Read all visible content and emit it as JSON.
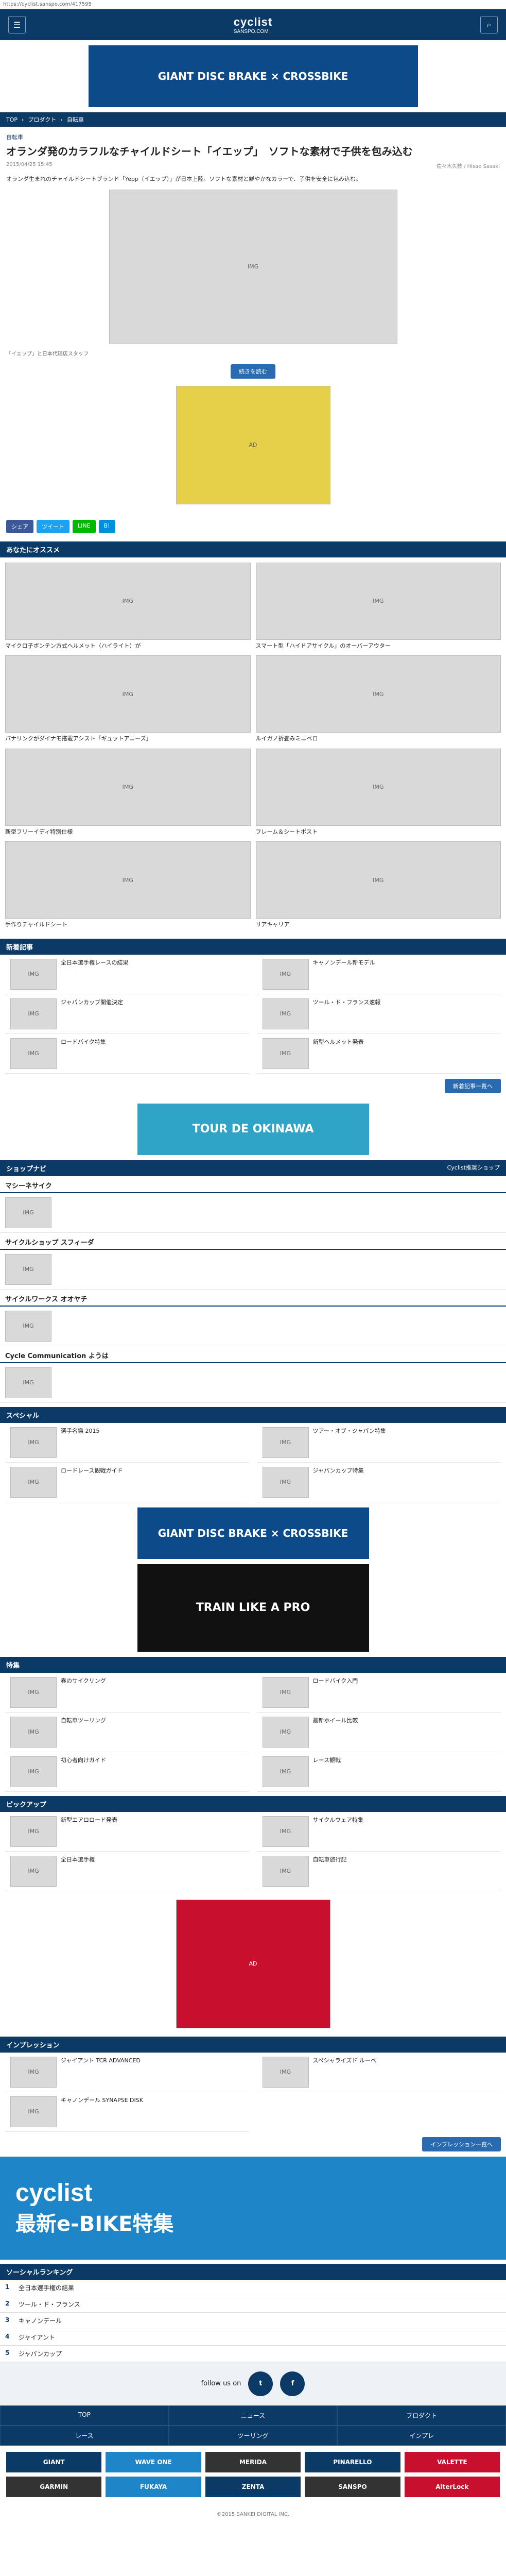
{
  "url": "https://cyclist.sanspo.com/417595",
  "header": {
    "logo": "cyclist",
    "logo_sub": "SANSPO.COM"
  },
  "banners": {
    "top": "GIANT DISC BRAKE × CROSSBIKE",
    "tour": "TOUR DE OKINAWA",
    "train": "TRAIN LIKE A PRO",
    "ebike": "最新e-BIKE特集",
    "ebike_word": "cyclist"
  },
  "breadcrumb": [
    "TOP",
    "プロダクト",
    "自転車"
  ],
  "article": {
    "category": "自転車",
    "title": "オランダ発のカラフルなチャイルドシート「イエップ」　ソフトな素材で子供を包み込む",
    "date": "2015/04/25 15:45",
    "author": "佐々木久枝 / Hisae Sasaki",
    "lead": "オランダ生まれのチャイルドシートブランド「Yepp（イエップ）」が日本上陸。ソフトな素材と鮮やかなカラーで、子供を安全に包み込む。",
    "caption": "「イエップ」と日本代理店スタッフ",
    "more_photos": "続きを読む"
  },
  "share": [
    "シェア",
    "ツイート",
    "LINE",
    "B!"
  ],
  "recommend": {
    "title": "あなたにオススメ",
    "items": [
      "マイクロ子ボンテン方式ヘルメット（ハイライト）が",
      "スマート型「ハイドアサイクル」のオーバーアウター",
      "パナリンクがダイナモ搭載アシスト「ギュットアニーズ」",
      "ルイガノ折畳みミニベロ",
      "新型フリーイディ特別仕様",
      "フレーム＆シートポスト",
      "手作りチャイルドシート",
      "リアキャリア"
    ]
  },
  "news": {
    "title": "新着記事",
    "items": [
      "全日本選手権レースの結果",
      "キャノンデール新モデル",
      "ジャパンカップ開催決定",
      "ツール・ド・フランス速報",
      "ロードバイク特集",
      "新型ヘルメット発表"
    ],
    "more": "新着記事一覧へ"
  },
  "shop": {
    "title": "ショップナビ",
    "sub": "Cyclist推奨ショップ",
    "items": [
      "マシーネサイク",
      "サイクルショップ スフィーダ",
      "サイクルワークス オオヤチ",
      "Cycle Communication ようは"
    ]
  },
  "special": {
    "title": "スペシャル",
    "items": [
      "選手名鑑 2015",
      "ツアー・オブ・ジャパン特集",
      "ロードレース観戦ガイド",
      "ジャパンカップ特集"
    ]
  },
  "feature": {
    "title": "特集",
    "items": [
      "春のサイクリング",
      "ロードバイク入門",
      "自転車ツーリング",
      "最新ホイール比較",
      "初心者向けガイド",
      "レース観戦"
    ]
  },
  "pickup": {
    "title": "ピックアップ",
    "items": [
      "新型エアロロード発表",
      "サイクルウェア特集",
      "全日本選手権",
      "自転車旅行記"
    ]
  },
  "impressions": {
    "title": "インプレッション",
    "items": [
      "ジャイアント TCR ADVANCED",
      "スペシャライズド ルーベ",
      "キャノンデール SYNAPSE DISK"
    ],
    "more": "インプレッション一覧へ"
  },
  "ranking": {
    "title": "ソーシャルランキング",
    "items": [
      "全日本選手権の結果",
      "ツール・ド・フランス",
      "キャノンデール",
      "ジャイアント",
      "ジャパンカップ"
    ]
  },
  "follow": {
    "text": "follow us on"
  },
  "footnav": [
    "TOP",
    "ニュース",
    "プロダクト",
    "レース",
    "ツーリング",
    "インプレ"
  ],
  "sponsors": [
    "GIANT",
    "WAVE ONE",
    "MERIDA",
    "PINARELLO",
    "VALETTE",
    "GARMIN",
    "FUKAYA",
    "ZENTA",
    "SANSPO",
    "AlterLock"
  ],
  "footer": {
    "copyright": "©2015 SANKEI DIGITAL INC."
  },
  "colors": {
    "brand": "#0c3a66",
    "accent": "#1e86c8"
  }
}
